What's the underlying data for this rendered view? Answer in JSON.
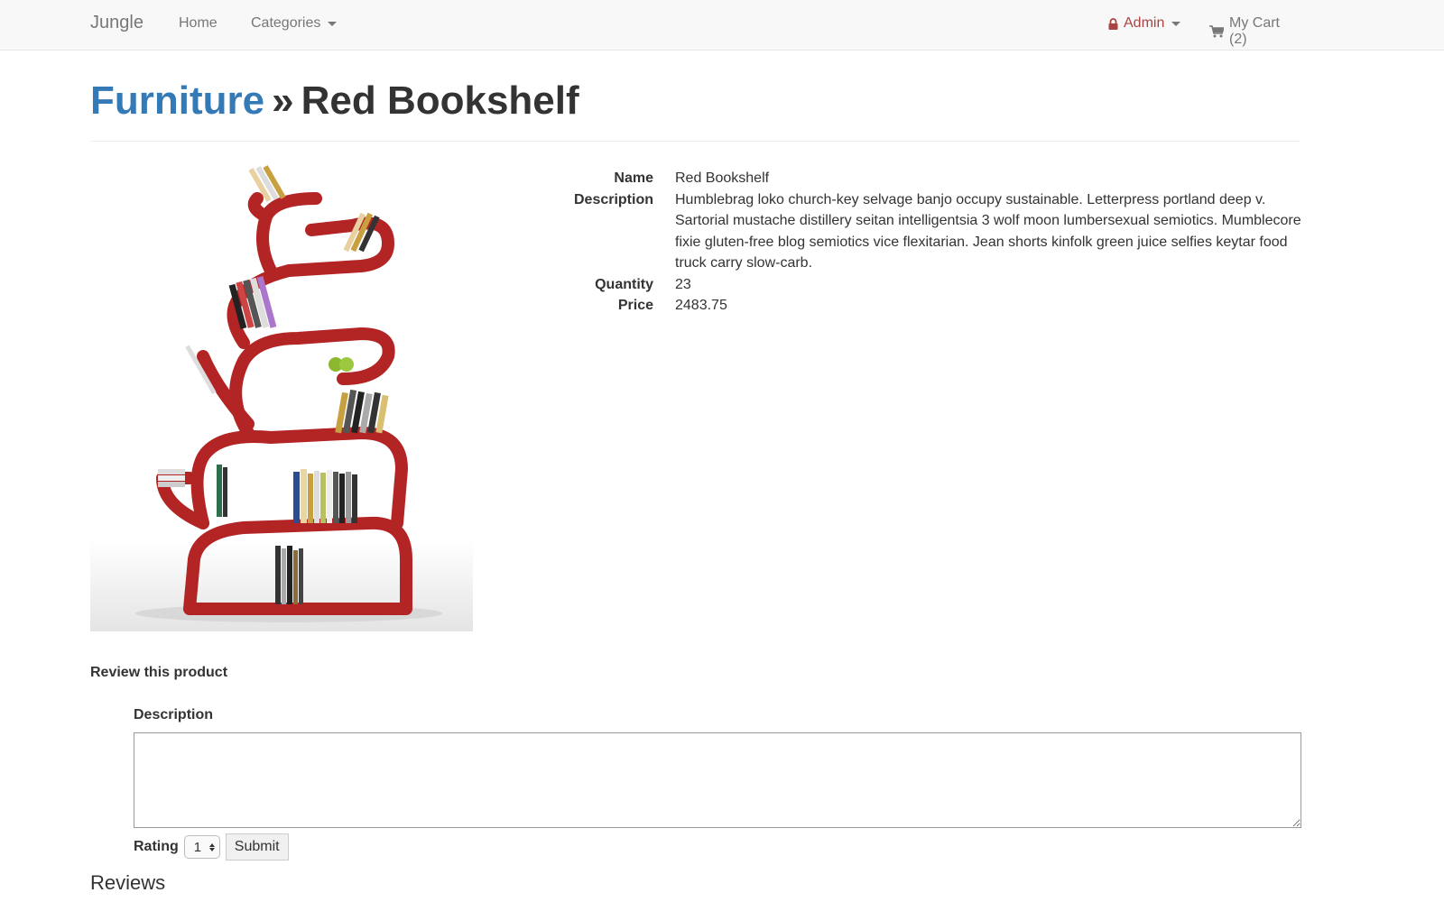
{
  "nav": {
    "brand": "Jungle",
    "home": "Home",
    "categories": "Categories",
    "admin": "Admin",
    "cart": "My Cart (2)"
  },
  "header": {
    "category": "Furniture",
    "separator": "»",
    "product_name": "Red Bookshelf"
  },
  "details": {
    "name_label": "Name",
    "name_value": "Red Bookshelf",
    "description_label": "Description",
    "description_value": "Humblebrag loko church-key selvage banjo occupy sustainable. Letterpress portland deep v. Sartorial mustache distillery seitan intelligentsia 3 wolf moon lumbersexual semiotics. Mumblecore fixie gluten-free blog semiotics vice flexitarian. Jean shorts kinfolk green juice selfies keytar food truck carry slow-carb.",
    "quantity_label": "Quantity",
    "quantity_value": "23",
    "price_label": "Price",
    "price_value": "2483.75"
  },
  "review_form": {
    "title": "Review this product",
    "description_label": "Description",
    "description_value": "",
    "rating_label": "Rating",
    "rating_selected": "1",
    "submit_label": "Submit"
  },
  "reviews": {
    "heading": "Reviews"
  },
  "colors": {
    "link": "#337ab7",
    "admin": "#a94442",
    "shelf": "#b32424"
  }
}
